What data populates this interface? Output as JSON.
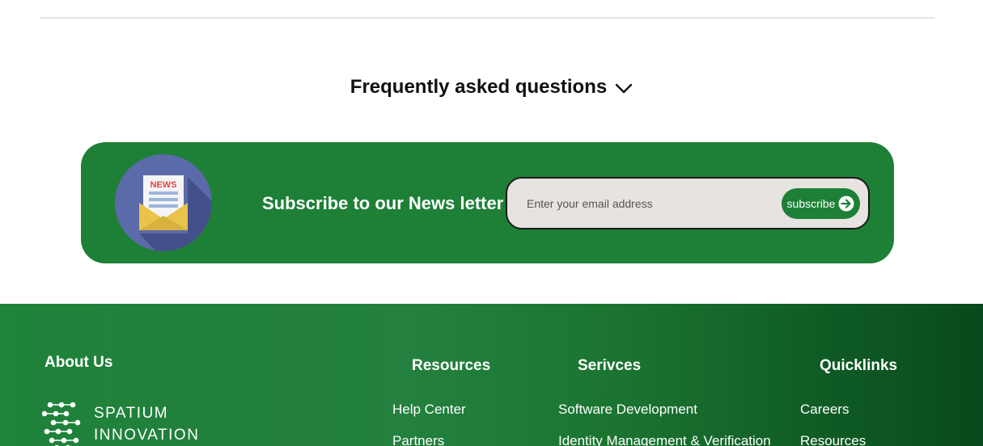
{
  "faq": {
    "title": "Frequently asked questions",
    "icon": "chevron-down-icon"
  },
  "newsletter": {
    "title": "Subscribe to our News letter",
    "icon_label": "NEWS",
    "email_placeholder": "Enter your email address",
    "subscribe_label": "subscribe",
    "background_color": "#1e8036"
  },
  "footer": {
    "about_title": "About Us",
    "logo": {
      "line1": "SPATIUM",
      "line2": "INNOVATION"
    },
    "resources": {
      "title": "Resources",
      "links": [
        "Help Center",
        "Partners"
      ]
    },
    "services": {
      "title": "Serivces",
      "links": [
        "Software Development",
        "Identity Management & Verification"
      ]
    },
    "quicklinks": {
      "title": "Quicklinks",
      "links": [
        "Careers",
        "Resources"
      ]
    }
  }
}
